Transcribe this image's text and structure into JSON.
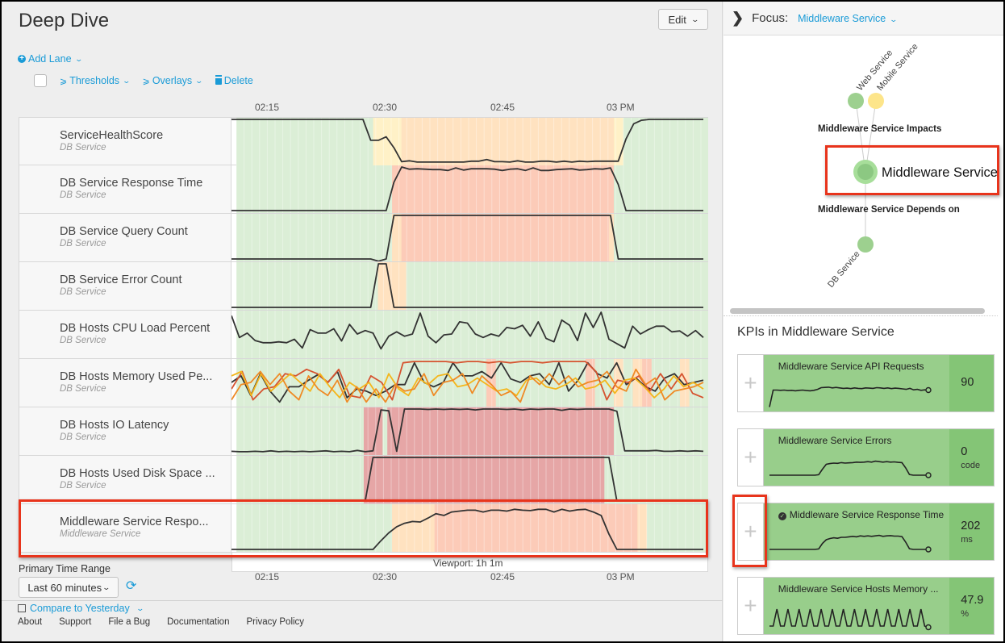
{
  "page": {
    "title": "Deep Dive",
    "edit_label": "Edit"
  },
  "toolbar": {
    "add_lane_label": "Add Lane",
    "thresholds_label": "Thresholds",
    "overlays_label": "Overlays",
    "delete_label": "Delete"
  },
  "timeline": {
    "ticks": [
      "02:15",
      "02:30",
      "02:45",
      "03 PM"
    ],
    "viewport_label": "Viewport: 1h 1m"
  },
  "colors": {
    "normal": "#dbeed6",
    "low": "#fff1c7",
    "medium": "#ffe2c0",
    "high": "#fccbb8",
    "critical": "#e6a6a6",
    "line": "#333333",
    "series_red": "#d6532f",
    "series_orange": "#ef8a25",
    "series_yellow": "#f4b61c",
    "accent_link": "#1a9bd7",
    "highlight": "#e8341c",
    "kpi_green": "#98ce8b",
    "kpi_green_dark": "#84c576"
  },
  "lanes": [
    {
      "title": "ServiceHealthScore",
      "service": "DB Service",
      "bands": [
        [
          "normal",
          0,
          0.29
        ],
        [
          "low",
          0.29,
          0.35
        ],
        [
          "medium",
          0.35,
          0.8
        ],
        [
          "low",
          0.8,
          0.82
        ],
        [
          "normal",
          0.82,
          1
        ]
      ],
      "series": [
        [
          1,
          1,
          1,
          1,
          1,
          1,
          1,
          1,
          1,
          1,
          1,
          1,
          1,
          1,
          1,
          1,
          1,
          1,
          0.52,
          0.52,
          0.6,
          0.35,
          0.03,
          0.05,
          0.02,
          0.02,
          0.02,
          0.02,
          0.02,
          0.02,
          0.02,
          0.04,
          0.04,
          0.08,
          0.03,
          0.03,
          0.02,
          0.05,
          0.02,
          0.02,
          0.04,
          0.04,
          0.02,
          0.04,
          0.02,
          0.04,
          0.03,
          0.04,
          0.04,
          0.04,
          0.04,
          0.55,
          0.9,
          0.98,
          1,
          1,
          1,
          1,
          1,
          1,
          1,
          1
        ]
      ]
    },
    {
      "title": "DB Service Response Time",
      "service": "DB Service",
      "bands": [
        [
          "normal",
          0,
          0.33
        ],
        [
          "high",
          0.33,
          0.8
        ],
        [
          "normal",
          0.8,
          1
        ]
      ],
      "series": [
        [
          0,
          0,
          0,
          0,
          0,
          0,
          0,
          0,
          0,
          0,
          0,
          0,
          0,
          0,
          0,
          0,
          0,
          0,
          0,
          0,
          0,
          0.65,
          1,
          0.95,
          0.96,
          0.95,
          0.94,
          0.94,
          0.92,
          0.98,
          0.93,
          0.96,
          0.96,
          0.96,
          0.95,
          0.92,
          0.95,
          0.96,
          0.92,
          0.98,
          0.92,
          0.92,
          0.94,
          0.95,
          0.96,
          0.93,
          0.94,
          0.96,
          0.95,
          0.98,
          0.6,
          0,
          0,
          0,
          0,
          0,
          0,
          0,
          0,
          0,
          0,
          0
        ]
      ]
    },
    {
      "title": "DB Service Query Count",
      "service": "DB Service",
      "bands": [
        [
          "normal",
          0,
          0.33
        ],
        [
          "medium",
          0.33,
          0.35
        ],
        [
          "high",
          0.35,
          0.79
        ],
        [
          "medium",
          0.79,
          0.8
        ],
        [
          "normal",
          0.8,
          1
        ]
      ],
      "series": [
        [
          0,
          0,
          0,
          0,
          0,
          0,
          0,
          0,
          0,
          0,
          0,
          0,
          0,
          0,
          0,
          0,
          0,
          0,
          0,
          -0.05,
          0,
          1,
          1,
          1,
          1,
          1,
          1,
          1,
          1,
          1,
          1,
          1,
          1,
          1,
          1,
          1,
          1,
          1,
          1,
          1,
          1,
          1,
          1,
          1,
          1,
          1,
          1,
          1,
          1,
          1,
          0,
          0,
          0,
          0,
          0,
          0,
          0,
          0,
          0,
          0,
          0,
          0
        ]
      ]
    },
    {
      "title": "DB Service Error Count",
      "service": "DB Service",
      "bands": [
        [
          "normal",
          0,
          0.3
        ],
        [
          "medium",
          0.3,
          0.36
        ],
        [
          "normal",
          0.36,
          1
        ]
      ],
      "series": [
        [
          0,
          0,
          0,
          0,
          0,
          0,
          0,
          0,
          0,
          0,
          0,
          0,
          0,
          0,
          0,
          0,
          0,
          0,
          0,
          1,
          1,
          0,
          0,
          0,
          0,
          0,
          0,
          0,
          0,
          0,
          0,
          0,
          0,
          0,
          0,
          0,
          0,
          0,
          0,
          0,
          0,
          0,
          0,
          0,
          0,
          0,
          0,
          0,
          0,
          0,
          0,
          0,
          0,
          0,
          0,
          0,
          0,
          0,
          0,
          0,
          0,
          0
        ]
      ]
    },
    {
      "title": "DB Hosts CPU Load Percent",
      "service": "DB Service",
      "bands": [
        [
          "normal",
          0,
          1
        ]
      ],
      "series": [
        [
          0.92,
          0.42,
          0.52,
          0.35,
          0.3,
          0.3,
          0.32,
          0.3,
          0.38,
          0.18,
          0.6,
          0.52,
          0.52,
          0.62,
          0.34,
          0.72,
          0.5,
          0.58,
          0.52,
          0.16,
          0.45,
          0.55,
          0.45,
          0.5,
          0.98,
          0.45,
          0.3,
          0.48,
          0.5,
          0.78,
          0.75,
          0.5,
          0.42,
          0.5,
          0.45,
          0.65,
          0.62,
          0.7,
          0.45,
          0.78,
          0.4,
          0.32,
          0.82,
          0.7,
          0.35,
          0.98,
          0.65,
          1,
          0.38,
          0.28,
          0.18,
          0.68,
          0.5,
          0.6,
          0.68,
          0.68,
          0.55,
          0.57,
          0.45,
          0.58,
          0.42
        ]
      ]
    },
    {
      "title": "DB Hosts Memory Used Pe...",
      "service": "DB Service",
      "bands": [
        [
          "normal",
          0,
          0.53
        ],
        [
          "high",
          0.53,
          0.55
        ],
        [
          "normal",
          0.55,
          0.74
        ],
        [
          "high",
          0.74,
          0.76
        ],
        [
          "normal",
          0.76,
          0.8
        ],
        [
          "medium",
          0.8,
          0.82
        ],
        [
          "normal",
          0.82,
          0.84
        ],
        [
          "medium",
          0.84,
          0.86
        ],
        [
          "high",
          0.86,
          0.88
        ],
        [
          "normal",
          0.88,
          0.94
        ],
        [
          "medium",
          0.94,
          0.96
        ],
        [
          "normal",
          0.96,
          1
        ]
      ],
      "series": [
        [
          0.5,
          0.65,
          0.2,
          0.7,
          0.3,
          0.05,
          0.4,
          0.4,
          0.55,
          0.68,
          0.5,
          0.75,
          0.15,
          0.35,
          0.3,
          0.2,
          0.3,
          0.45,
          0.45,
          0.95,
          0.5,
          0.4,
          0.5,
          0.95,
          0.65,
          0.65,
          0.75,
          0.6,
          0.95,
          0.58,
          0.5,
          0.65,
          0.7,
          0.45,
          0.95,
          0.3,
          0.55,
          0.95,
          0.7,
          0.6,
          0.95,
          0.45,
          0.6,
          0.4,
          0.3,
          0.6,
          0.7,
          0.45,
          0.5,
          0.55
        ],
        [
          0.35,
          0.75,
          0.1,
          0.35,
          0.4,
          0.7,
          0.65,
          0.8,
          0.7,
          0.5,
          0.8,
          0.2,
          0.15,
          0.65,
          0.5,
          0.1,
          0.95,
          0.98,
          0.98,
          0.98,
          0.98,
          0.95,
          0.98,
          0.98,
          0.95,
          0.98,
          0.95,
          0.98,
          0.98,
          0.95,
          0.98,
          0.98,
          0.98,
          0.98,
          0.75,
          0.1,
          0.55,
          0.5,
          0.65,
          0.3,
          0.7,
          0.35,
          0.7,
          0.25,
          0.15
        ],
        [
          0.65,
          0.75,
          0.2,
          0.7,
          0.3,
          0.5,
          0.7,
          0.5,
          0.3,
          0.7,
          0.4,
          0.15,
          0.5,
          0.35,
          0.5,
          0.15,
          0.7,
          0.35,
          0.2,
          0.6,
          0.45,
          0.65,
          0.7,
          0.4,
          0.45,
          0.6,
          0.45,
          0.3,
          0.35,
          0.2,
          0.55,
          0.6,
          0.4,
          0.35,
          0.45,
          0.6,
          0.35,
          0.4,
          0.55,
          0.25,
          0.55,
          0.6,
          0.4,
          0.15,
          0.35,
          0.65,
          0.4,
          0.5,
          0.35
        ],
        [
          0.1,
          0.45,
          0.5,
          0.75,
          0.45,
          0.7,
          0.3,
          0.1,
          0.65,
          0.35,
          0.2,
          0.55,
          0.05,
          0.4,
          0.05,
          0.35,
          0.05,
          0.45,
          0.3,
          0.35,
          0.7,
          0.2,
          0.5,
          0.55,
          0.7,
          0.25,
          0.65,
          0.45,
          0.2,
          0.3,
          0.05,
          0.65,
          0.45,
          0.7,
          0.45,
          0.65,
          0.4,
          0.5,
          0.55,
          0.75,
          0.4,
          0.3,
          0.8,
          0.45,
          0.6,
          0.1,
          0.3,
          0.35,
          0.4,
          0.5
        ]
      ]
    },
    {
      "title": "DB Hosts IO Latency",
      "service": "DB Service",
      "bands": [
        [
          "normal",
          0,
          0.27
        ],
        [
          "critical",
          0.27,
          0.31
        ],
        [
          "normal",
          0.31,
          0.32
        ],
        [
          "critical",
          0.32,
          0.8
        ],
        [
          "normal",
          0.8,
          1
        ]
      ],
      "series": [
        [
          0.03,
          0.02,
          0.02,
          0.03,
          0.02,
          0.04,
          0.02,
          0.03,
          0.02,
          0.03,
          0.02,
          0.03,
          0.04,
          0.02,
          0.03,
          0.02,
          0.05,
          0.02,
          0.04,
          0.98,
          0.96,
          0.03,
          1,
          1,
          1,
          0.99,
          1,
          0.99,
          1,
          0.99,
          1,
          0.98,
          1,
          1,
          1,
          0.99,
          1,
          0.98,
          1,
          0.99,
          1,
          1,
          0.97,
          1,
          0.99,
          1,
          1,
          1,
          1,
          0.95,
          0.04,
          0.04,
          0.04,
          0.04,
          0.05,
          0.03,
          0.03,
          0.04,
          0.03,
          0.04,
          0.03
        ]
      ]
    },
    {
      "title": "DB Hosts Used Disk Space ...",
      "service": "DB Service",
      "bands": [
        [
          "normal",
          0,
          0.27
        ],
        [
          "critical",
          0.27,
          0.78
        ],
        [
          "normal",
          0.78,
          1
        ]
      ],
      "series": [
        [
          0,
          0,
          0,
          0,
          0,
          0,
          0,
          0,
          0,
          0,
          0,
          0,
          0,
          0,
          0,
          0,
          0,
          0,
          1,
          1,
          1,
          1,
          1,
          1,
          1,
          1,
          1,
          1,
          1,
          1,
          1,
          1,
          1,
          1,
          1,
          1,
          1,
          1,
          1,
          1,
          1,
          1,
          1,
          1,
          1,
          1,
          1,
          1,
          1,
          0,
          0,
          0,
          0,
          0,
          0,
          0,
          0,
          0,
          0,
          0,
          0
        ]
      ]
    },
    {
      "title": "Middleware Service Respo...",
      "service": "Middleware Service",
      "bands": [
        [
          "normal",
          0,
          0.33
        ],
        [
          "medium",
          0.33,
          0.42
        ],
        [
          "high",
          0.42,
          0.85
        ],
        [
          "medium",
          0.85,
          0.87
        ],
        [
          "normal",
          0.87,
          1
        ]
      ],
      "series": [
        [
          0,
          0,
          0,
          0,
          0,
          0,
          0,
          0,
          0,
          0,
          0,
          0,
          0,
          0,
          0,
          0,
          0,
          0,
          0,
          0.2,
          0.38,
          0.52,
          0.6,
          0.64,
          0.63,
          0.72,
          0.82,
          0.78,
          0.86,
          0.88,
          0.9,
          0.9,
          0.86,
          0.9,
          0.9,
          0.88,
          0.92,
          0.9,
          0.89,
          0.92,
          0.92,
          0.86,
          0.92,
          0.88,
          0.91,
          0.92,
          0.86,
          0.78,
          0.35,
          0,
          0,
          0,
          0,
          0,
          0,
          0,
          0,
          0,
          0,
          0,
          0
        ]
      ]
    }
  ],
  "bottom": {
    "time_range_label": "Primary Time Range",
    "time_range_value": "Last 60 minutes",
    "compare_label": "Compare to Yesterday",
    "footer_links": [
      "About",
      "Support",
      "File a Bug",
      "Documentation",
      "Privacy Policy"
    ]
  },
  "focus": {
    "label": "Focus:",
    "selected": "Middleware Service",
    "impacts_label": "Middleware Service Impacts",
    "depends_label": "Middleware Service Depends on",
    "focus_node": "Middleware Service",
    "upstream_nodes": [
      {
        "name": "Web Service",
        "status_color": "#9dd08f"
      },
      {
        "name": "Mobile Service",
        "status_color": "#fde58a"
      }
    ],
    "downstream_nodes": [
      {
        "name": "DB Service",
        "status_color": "#9dd08f"
      }
    ]
  },
  "kpis": {
    "heading": "KPIs in Middleware Service",
    "items": [
      {
        "name": "Middleware Service API Requests",
        "value": "90",
        "unit": "",
        "checked": false,
        "spark": [
          0.05,
          0.75,
          0.75,
          0.74,
          0.75,
          0.73,
          0.74,
          0.72,
          0.74,
          0.75,
          0.73,
          0.72,
          0.74,
          0.78,
          0.85,
          0.86,
          0.87,
          0.84,
          0.86,
          0.84,
          0.82,
          0.83,
          0.81,
          0.84,
          0.82,
          0.81,
          0.84,
          0.83,
          0.82,
          0.85,
          0.84,
          0.82,
          0.84,
          0.81,
          0.83,
          0.82,
          0.8,
          0.78,
          0.82,
          0.76,
          0.78,
          0.74,
          0.76,
          0.75
        ]
      },
      {
        "name": "Middleware Service Errors",
        "value": "0",
        "unit": "code",
        "checked": false,
        "spark": [
          0.3,
          0.3,
          0.3,
          0.3,
          0.3,
          0.3,
          0.3,
          0.3,
          0.3,
          0.3,
          0.3,
          0.3,
          0.3,
          0.32,
          0.55,
          0.75,
          0.78,
          0.8,
          0.79,
          0.82,
          0.8,
          0.81,
          0.82,
          0.84,
          0.83,
          0.84,
          0.86,
          0.84,
          0.88,
          0.86,
          0.84,
          0.86,
          0.84,
          0.85,
          0.83,
          0.82,
          0.6,
          0.33,
          0.3,
          0.3,
          0.3,
          0.3,
          0.3
        ]
      },
      {
        "name": "Middleware Service Response Time",
        "value": "202",
        "unit": "ms",
        "checked": true,
        "spark": [
          0.3,
          0.3,
          0.3,
          0.3,
          0.3,
          0.3,
          0.3,
          0.3,
          0.3,
          0.3,
          0.3,
          0.3,
          0.3,
          0.32,
          0.55,
          0.7,
          0.75,
          0.78,
          0.76,
          0.8,
          0.8,
          0.82,
          0.84,
          0.82,
          0.86,
          0.84,
          0.86,
          0.84,
          0.86,
          0.88,
          0.84,
          0.86,
          0.87,
          0.85,
          0.85,
          0.83,
          0.6,
          0.33,
          0.3,
          0.3,
          0.3,
          0.3,
          0.3
        ]
      },
      {
        "name": "Middleware Service Hosts Memory ...",
        "value": "47.9",
        "unit": "%",
        "checked": false,
        "spark": [
          0.2,
          0.2,
          0.9,
          0.2,
          0.2,
          0.9,
          0.2,
          0.2,
          0.9,
          0.2,
          0.2,
          0.9,
          0.2,
          0.2,
          0.9,
          0.2,
          0.2,
          0.9,
          0.2,
          0.2,
          0.9,
          0.2,
          0.2,
          0.9,
          0.2,
          0.2,
          0.9,
          0.2,
          0.2,
          0.9,
          0.2,
          0.2,
          0.9,
          0.2,
          0.2,
          0.9,
          0.2,
          0.2,
          0.9,
          0.2,
          0.2,
          0.9,
          0.2,
          0.15
        ]
      }
    ]
  }
}
